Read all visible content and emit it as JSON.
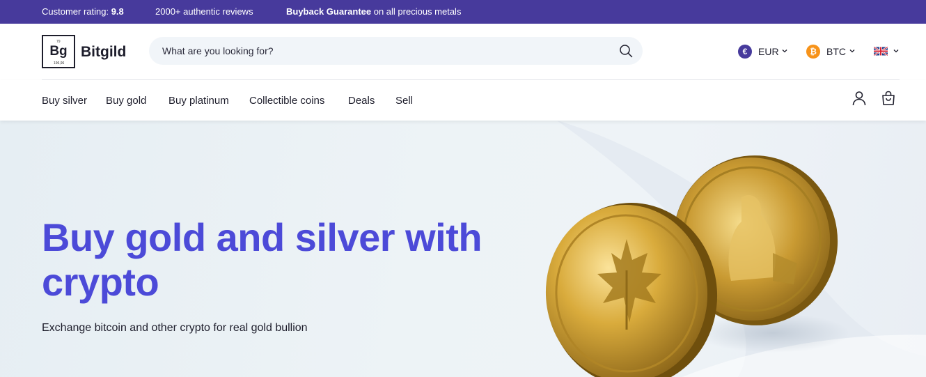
{
  "topbar": {
    "rating_label": "Customer rating: ",
    "rating_value": "9.8",
    "reviews": "2000+ authentic reviews",
    "buyback_bold": "Buyback Guarantee",
    "buyback_rest": " on all precious metals"
  },
  "logo": {
    "atomic_number": "79",
    "symbol": "Bg",
    "atomic_mass": "196,96",
    "name": "Bitgild"
  },
  "search": {
    "placeholder": "What are you looking for?",
    "icon": "search-icon"
  },
  "selectors": {
    "currency": "EUR",
    "currency_symbol": "€",
    "crypto": "BTC",
    "crypto_symbol": "₿",
    "language_icon": "uk-flag-icon"
  },
  "nav": {
    "items": [
      "Buy silver",
      "Buy gold",
      "Buy platinum",
      "Collectible coins",
      "Deals",
      "Sell"
    ],
    "account_icon": "user-icon",
    "cart_icon": "cart-icon"
  },
  "hero": {
    "title": "Buy gold and silver with crypto",
    "subtitle": "Exchange bitcoin and other crypto for real gold bullion",
    "image_icon": "gold-coins-image"
  },
  "colors": {
    "topbar_bg": "#473a9c",
    "accent": "#4c4ad8",
    "euro_coin": "#473a9c",
    "btc_coin": "#f7931a",
    "gold": "#d4a935"
  }
}
